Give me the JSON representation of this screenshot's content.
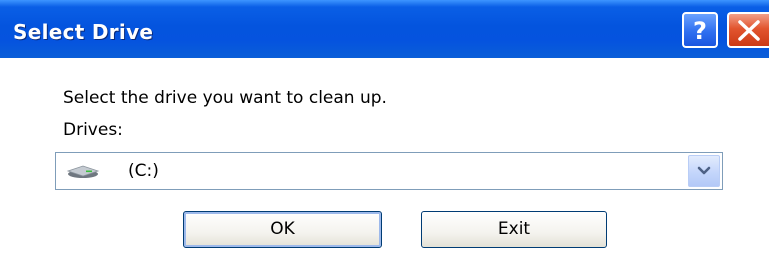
{
  "window": {
    "title": "Select Drive"
  },
  "titlebar_buttons": {
    "help": {
      "icon": "question-mark-icon",
      "glyph": "?"
    },
    "close": {
      "icon": "close-x-icon"
    }
  },
  "dialog": {
    "prompt": "Select the drive you want to clean up.",
    "drives_label": "Drives:",
    "drive_select": {
      "selected_value": "(C:)",
      "icon": "hard-drive-icon"
    }
  },
  "buttons": {
    "ok_label": "OK",
    "exit_label": "Exit"
  },
  "colors": {
    "titlebar_blue": "#0454de",
    "close_red": "#e2552f",
    "help_blue": "#2f6ff0",
    "button_border": "#003c74"
  }
}
